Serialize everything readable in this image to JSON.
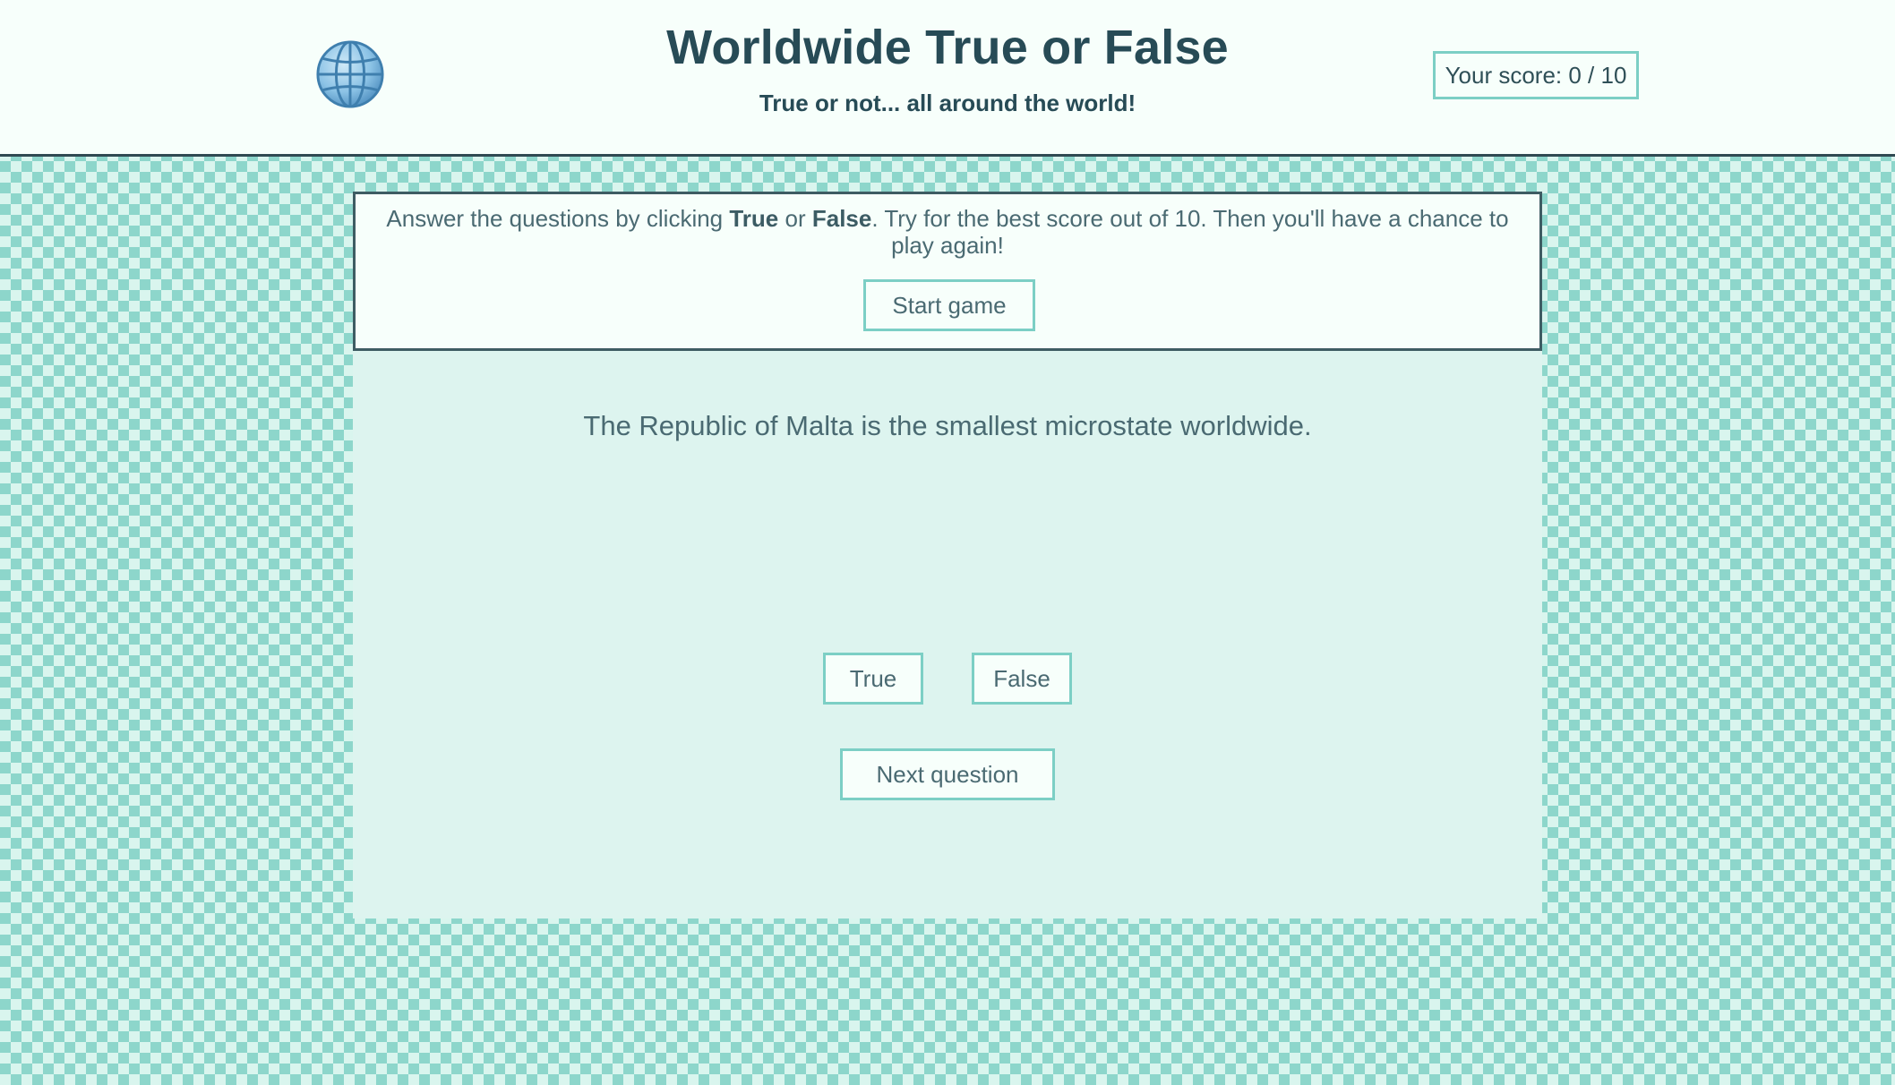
{
  "header": {
    "title": "Worldwide True or False",
    "subtitle": "True or not... all around the world!",
    "logo_icon": "globe-icon",
    "score_label": "Your score: 0 / 10"
  },
  "intro": {
    "text_before_true": "Answer the questions by clicking ",
    "true_word": "True",
    "text_or": " or ",
    "false_word": "False",
    "text_after": ". Try for the best score out of 10. Then you'll have a chance to play again!",
    "start_button": "Start game"
  },
  "question": {
    "text": "The Republic of Malta is the smallest microstate worldwide.",
    "true_button": "True",
    "false_button": "False",
    "next_button": "Next question"
  },
  "colors": {
    "accent_border": "#7ccfc5",
    "dark_text": "#274b56",
    "panel_bg": "#f7fffb",
    "question_bg": "#ddf4ef",
    "checker_light": "#d9f5ee",
    "checker_dark": "#8dd6cb"
  }
}
